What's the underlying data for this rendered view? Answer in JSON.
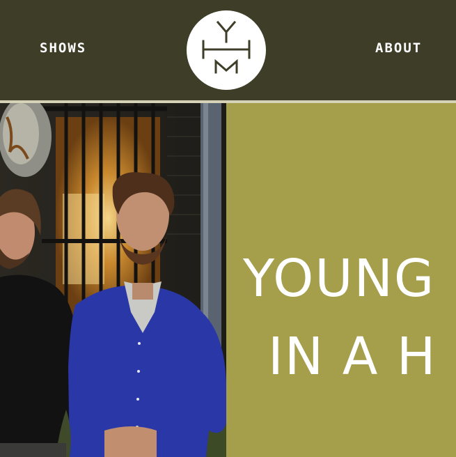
{
  "nav": {
    "left_label": "SHOWS",
    "right_label": "ABOUT"
  },
  "logo": {
    "letters": [
      "Y",
      "H",
      "M"
    ]
  },
  "hero": {
    "title_line1": "YOUNG",
    "title_line2": "IN A H"
  },
  "colors": {
    "header_bg": "#3e3e28",
    "panel_bg": "#a59e4b",
    "divider": "#d6d2b8",
    "text": "#ffffff"
  }
}
